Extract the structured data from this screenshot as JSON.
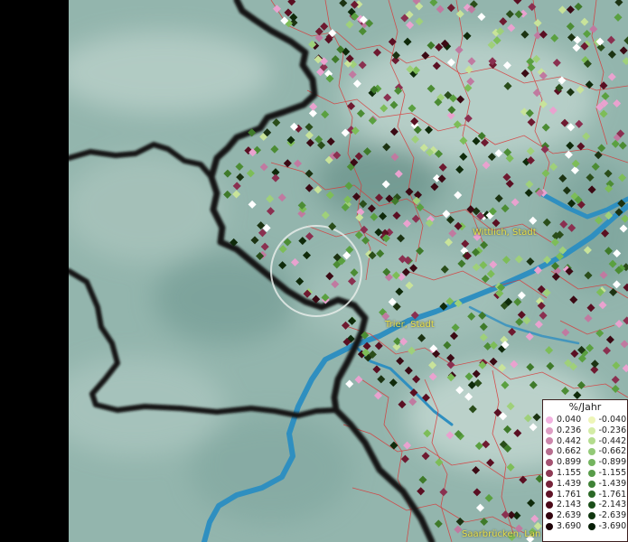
{
  "map": {
    "place_labels": {
      "wittlich": "Wittlich, Stadt",
      "trier": "Trier, Stadt",
      "saarbruecken": "Saarbrücken, Lan"
    },
    "colors": {
      "terrain": "#8fb3aa",
      "water": "#2f8fc0",
      "border": "#141414",
      "district_lines": "#d83a3a",
      "label_text": "#e8e04a"
    }
  },
  "legend": {
    "title": "%/Jahr",
    "increase": [
      {
        "label": "0.040",
        "color": "#f2b3e0"
      },
      {
        "label": "0.236",
        "color": "#de9ec4"
      },
      {
        "label": "0.442",
        "color": "#cc86ab"
      },
      {
        "label": "0.662",
        "color": "#b76d8e"
      },
      {
        "label": "0.899",
        "color": "#a45271"
      },
      {
        "label": "1.155",
        "color": "#8e3a55"
      },
      {
        "label": "1.439",
        "color": "#76233a"
      },
      {
        "label": "1.761",
        "color": "#5f1226"
      },
      {
        "label": "2.143",
        "color": "#4a0817"
      },
      {
        "label": "2.639",
        "color": "#33040e"
      },
      {
        "label": "3.690",
        "color": "#1c0206"
      }
    ],
    "decrease": [
      {
        "label": "-0.040",
        "color": "#eef5b8"
      },
      {
        "label": "-0.236",
        "color": "#d4eca6"
      },
      {
        "label": "-0.442",
        "color": "#b4dc8e"
      },
      {
        "label": "-0.662",
        "color": "#93c977"
      },
      {
        "label": "-0.899",
        "color": "#74b45f"
      },
      {
        "label": "-1.155",
        "color": "#589c49"
      },
      {
        "label": "-1.439",
        "color": "#3f8236"
      },
      {
        "label": "-1.761",
        "color": "#2b6826"
      },
      {
        "label": "-2.143",
        "color": "#1b4e19"
      },
      {
        "label": "-2.639",
        "color": "#10360f"
      },
      {
        "label": "-3.690",
        "color": "#071e07"
      }
    ]
  }
}
